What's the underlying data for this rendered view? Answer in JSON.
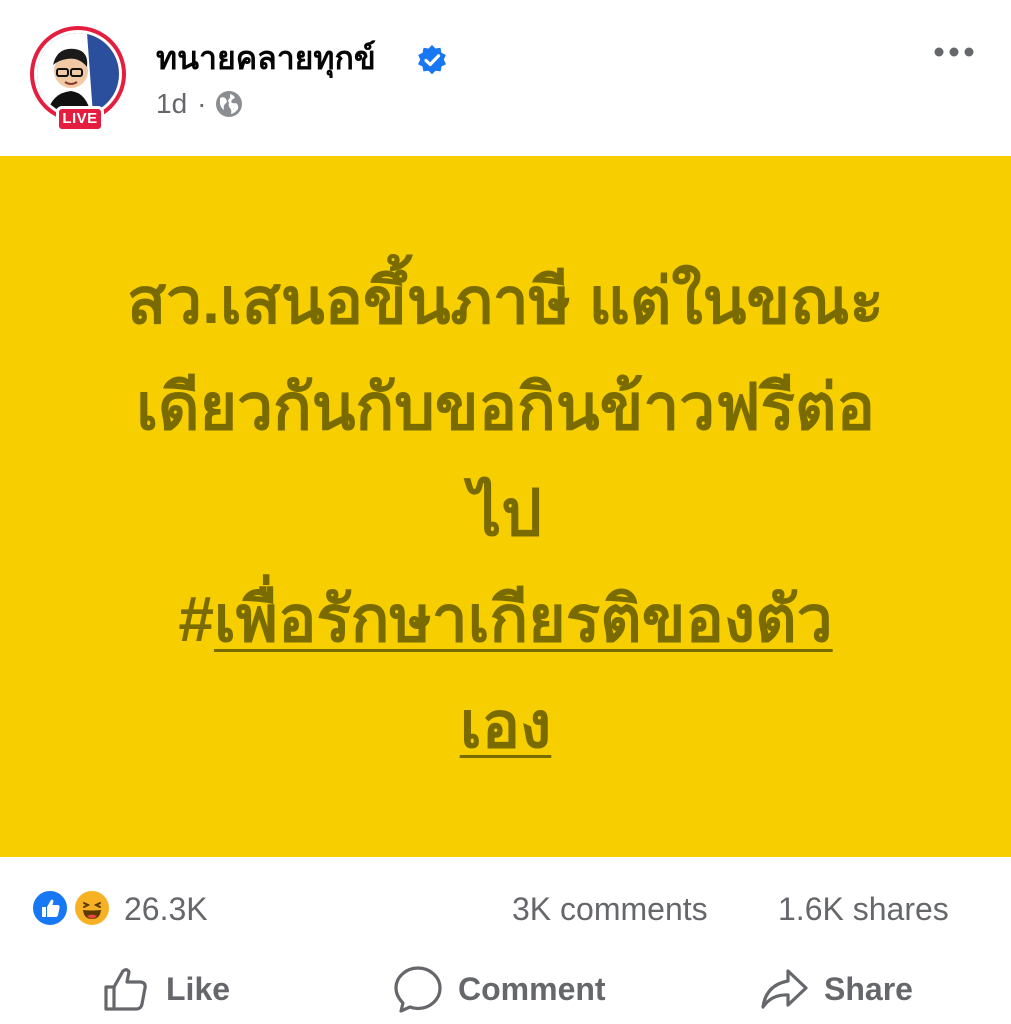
{
  "post": {
    "page_name": "ทนายคลายทุกข์",
    "live_badge": "LIVE",
    "timestamp": "1d",
    "separator": "·",
    "lines": [
      "สว.เสนอขึ้นภาษี แต่ในขณะ",
      "เดียวกันกับขอกินข้าวฟรีต่อ",
      "ไป"
    ],
    "hashtag_prefix": "#",
    "hashtag_part1": "เพื่อรักษาเกียรติของตัว",
    "hashtag_part2": "เอง",
    "background_color": "#f7ce00",
    "text_color": "#7a6b00"
  },
  "stats": {
    "reactions_count": "26.3K",
    "reaction_icons": [
      "like-icon",
      "haha-icon"
    ],
    "comments": "3K comments",
    "shares": "1.6K shares"
  },
  "actions": {
    "like_label": "Like",
    "comment_label": "Comment",
    "share_label": "Share"
  },
  "colors": {
    "live_red": "#e41e3f",
    "facebook_blue": "#1877f2",
    "secondary_text": "#65676b"
  }
}
